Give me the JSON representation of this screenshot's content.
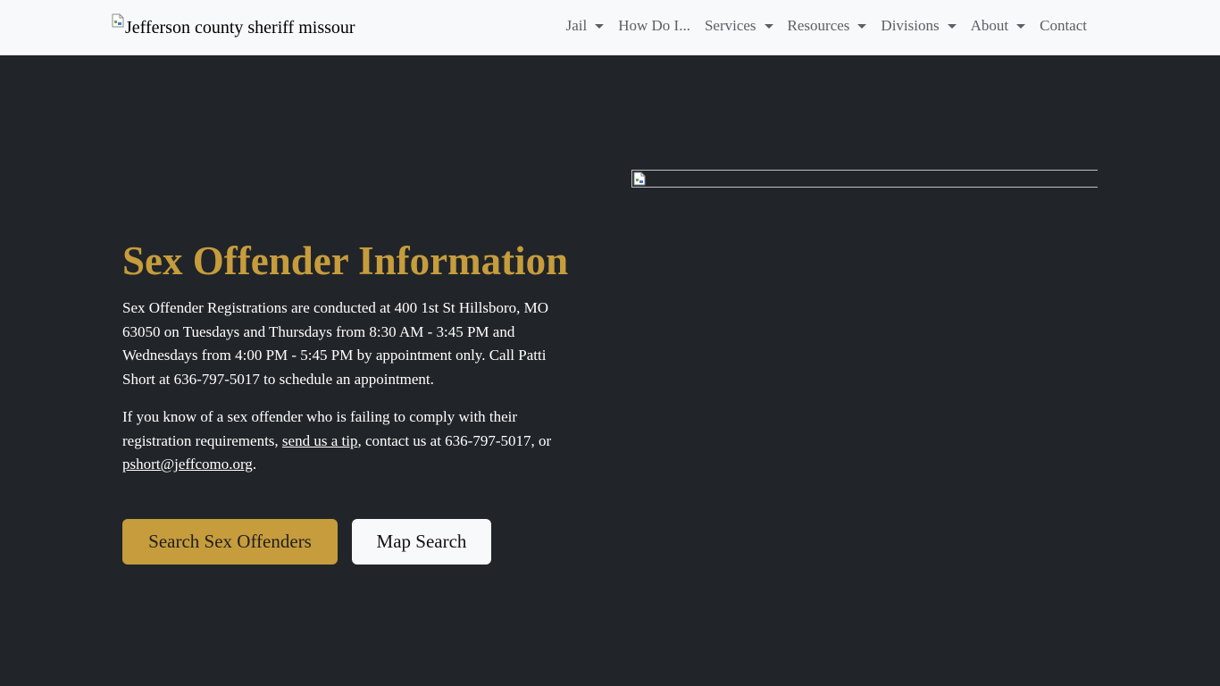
{
  "header": {
    "brand_alt": "Jefferson county sheriff missour",
    "nav": [
      {
        "label": "Jail",
        "dropdown": true
      },
      {
        "label": "How Do I...",
        "dropdown": false
      },
      {
        "label": "Services",
        "dropdown": true
      },
      {
        "label": "Resources",
        "dropdown": true
      },
      {
        "label": "Divisions",
        "dropdown": true
      },
      {
        "label": "About",
        "dropdown": true
      },
      {
        "label": "Contact",
        "dropdown": false
      }
    ]
  },
  "hero": {
    "title": "Sex Offender Information",
    "paragraph1": "Sex Offender Registrations are conducted at 400 1st St Hillsboro, MO 63050 on Tuesdays and Thursdays from 8:30 AM - 3:45 PM and Wednesdays from 4:00 PM - 5:45 PM by appointment only. Call Patti Short at 636-797-5017 to schedule an appointment.",
    "paragraph2": {
      "text_before": "If you know of a sex offender who is failing to comply with their registration requirements, ",
      "tip_link": "send us a tip",
      "text_middle": ", contact us at 636-797-5017, or ",
      "email_link": "pshort@jeffcomo.org",
      "text_after": "."
    },
    "buttons": {
      "search": "Search Sex Offenders",
      "map": "Map Search"
    }
  },
  "colors": {
    "background": "#212529",
    "navbar": "#f8f9fa",
    "accent": "#c69c3c",
    "nav_text": "#5c5f63"
  }
}
